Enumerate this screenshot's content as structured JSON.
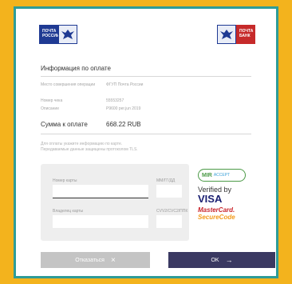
{
  "header": {
    "left_logo_line1": "ПОЧТА",
    "left_logo_line2": "РОССИИ",
    "right_logo_line1": "ПОЧТА",
    "right_logo_line2": "БАНК"
  },
  "payment_info": {
    "title": "Информация по оплате",
    "rows": [
      {
        "label": "Место совершения операции",
        "value": "ФГУП Почта России"
      },
      {
        "label": "Номер чека",
        "value": "55553257"
      },
      {
        "label": "Описание",
        "value": "P9600 per.jun 2019"
      }
    ],
    "sum_label": "Сумма к оплате",
    "sum_value": "668.22 RUB"
  },
  "note": {
    "line1": "Для оплаты укажите информацию по карте.",
    "line2": "Передаваемые данные защищены протоколом TLS."
  },
  "card_form": {
    "card_number_label": "Номер карты",
    "expiry_label": "ММ/ГГ/ДД",
    "holder_label": "Владелец карты",
    "cvv_label": "CVV2/CVC2/ППК"
  },
  "brands": {
    "mir": "MIR",
    "mir_accept": "ACCEPT",
    "verified_line1": "Verified by",
    "verified_line2": "VISA",
    "mc_line1": "MasterCard.",
    "mc_line2": "SecureCode"
  },
  "buttons": {
    "cancel_label": "Отказаться",
    "cancel_icon": "×",
    "ok_label": "OK",
    "ok_icon": "→"
  },
  "colors": {
    "background": "#f3b31d",
    "frame": "#2e9c98",
    "ok_button": "#3a3962",
    "cancel_button": "#c4c4c4"
  }
}
